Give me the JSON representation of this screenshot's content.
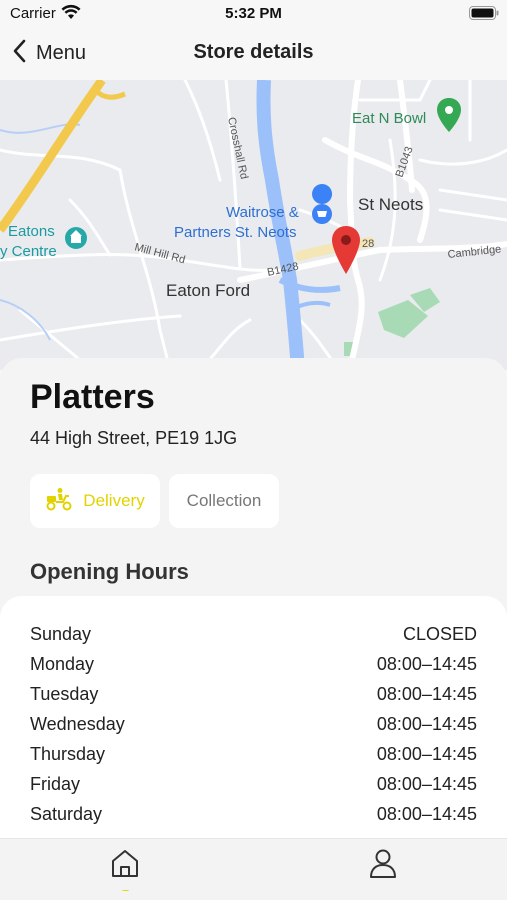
{
  "status_bar": {
    "carrier": "Carrier",
    "time": "5:32 PM",
    "icons": [
      "wifi-icon",
      "battery-icon"
    ]
  },
  "nav": {
    "back_label": "Menu",
    "title": "Store details"
  },
  "map": {
    "labels": {
      "eat_n_bowl": "Eat N Bowl",
      "st_neots": "St Neots",
      "waitrose_line1": "Waitrose &",
      "waitrose_line2": "Partners St. Neots",
      "eatons_line1": "Eatons",
      "eatons_line2": "y Centre",
      "eaton_ford": "Eaton Ford",
      "crosshall_rd": "Crosshall Rd",
      "mill_hill_rd": "Mill Hill Rd",
      "b1428_a": "B1428",
      "b1428_b": "28",
      "b1043": "B1043",
      "cambridge": "Cambridge"
    },
    "colors": {
      "road": "#ffffff",
      "river": "#9cc0f9",
      "major_road": "#f2c94c",
      "park": "#a8dab5",
      "pin": "#e53935"
    }
  },
  "store": {
    "name": "Platters",
    "address": "44 High Street, PE19 1JG"
  },
  "fulfilment": {
    "delivery_label": "Delivery",
    "collection_label": "Collection"
  },
  "hours": {
    "title": "Opening Hours",
    "rows": [
      {
        "day": "Sunday",
        "time": "CLOSED"
      },
      {
        "day": "Monday",
        "time": "08:00–14:45"
      },
      {
        "day": "Tuesday",
        "time": "08:00–14:45"
      },
      {
        "day": "Wednesday",
        "time": "08:00–14:45"
      },
      {
        "day": "Thursday",
        "time": "08:00–14:45"
      },
      {
        "day": "Friday",
        "time": "08:00–14:45"
      },
      {
        "day": "Saturday",
        "time": "08:00–14:45"
      }
    ]
  },
  "tabs": [
    {
      "name": "home",
      "icon": "home-icon",
      "active": true
    },
    {
      "name": "profile",
      "icon": "person-icon",
      "active": false
    }
  ],
  "colors": {
    "accent": "#e2d300",
    "background": "#f4f4f4",
    "card": "#ffffff"
  }
}
